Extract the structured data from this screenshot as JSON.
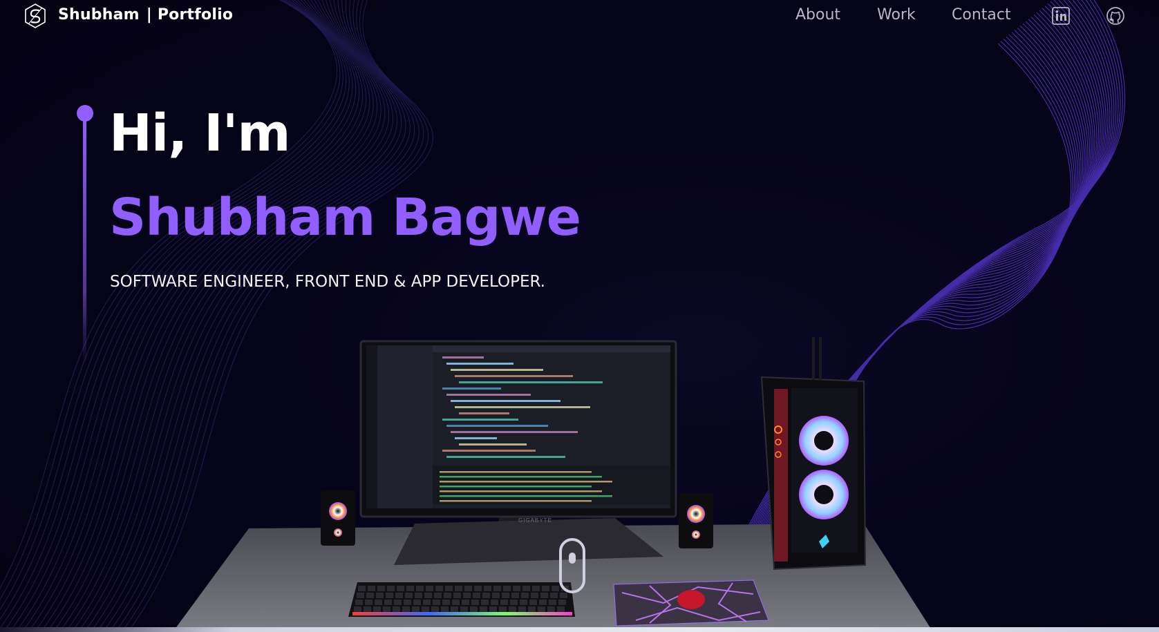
{
  "navbar": {
    "brand_name": "Shubham",
    "brand_suffix": "| Portfolio",
    "links": [
      "About",
      "Work",
      "Contact"
    ],
    "icons": [
      "linkedin-icon",
      "github-icon"
    ]
  },
  "hero": {
    "greeting": "Hi, I'm",
    "name": "Shubham Bagwe",
    "subtitle": "SOFTWARE ENGINEER, FRONT END & APP DEVELOPER."
  },
  "scene": {
    "monitor_brand": "GIGABYTE"
  },
  "colors": {
    "accent": "#915eff",
    "background": "#050314",
    "nav_text": "#b9b6c6"
  }
}
